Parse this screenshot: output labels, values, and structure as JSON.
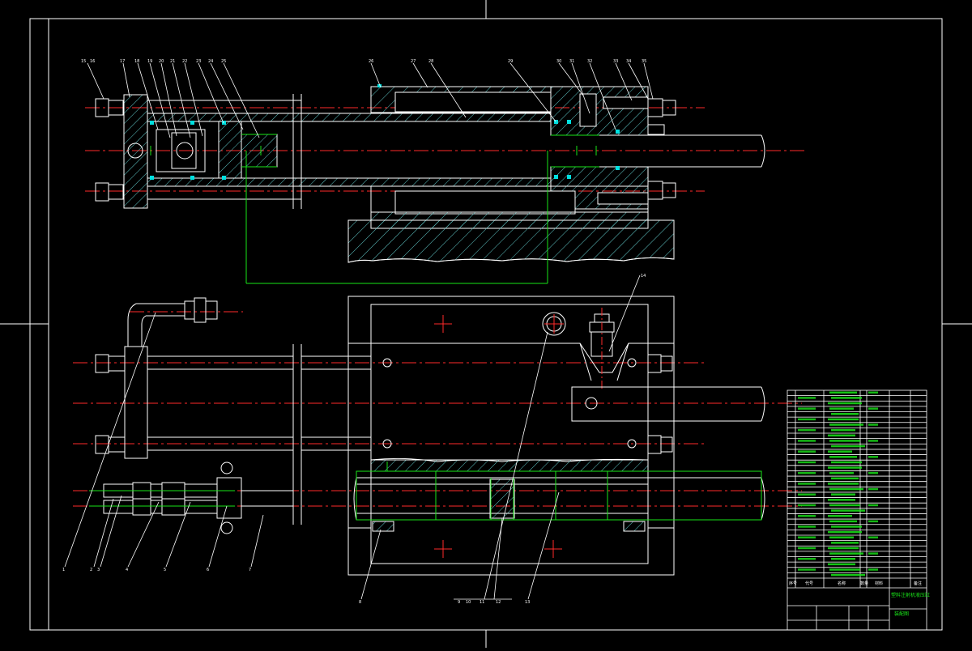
{
  "drawing": {
    "colors": {
      "background": "#000000",
      "line": "#ffffff",
      "centerline": "#ff2a2a",
      "hatch": "#5fc7c7",
      "dimension": "#19e619",
      "seal": "#00e0e0",
      "table_text": "#19e619"
    },
    "views": [
      "front-section-view",
      "top-view"
    ],
    "top_view_callouts": [
      "1",
      "2",
      "3",
      "4",
      "5",
      "6",
      "7",
      "8",
      "9",
      "10",
      "11",
      "12",
      "13",
      "14"
    ],
    "front_view_callouts": [
      "15",
      "16",
      "17",
      "18",
      "19",
      "20",
      "21",
      "22",
      "23",
      "24",
      "25",
      "26",
      "27",
      "28",
      "29",
      "30",
      "31",
      "32",
      "33",
      "34",
      "35"
    ],
    "title_block": {
      "headers": [
        "序号",
        "代号",
        "名称",
        "数量",
        "材料",
        "备注"
      ],
      "title": "塑料注射机液压缸",
      "subtitle": "装配图"
    }
  }
}
